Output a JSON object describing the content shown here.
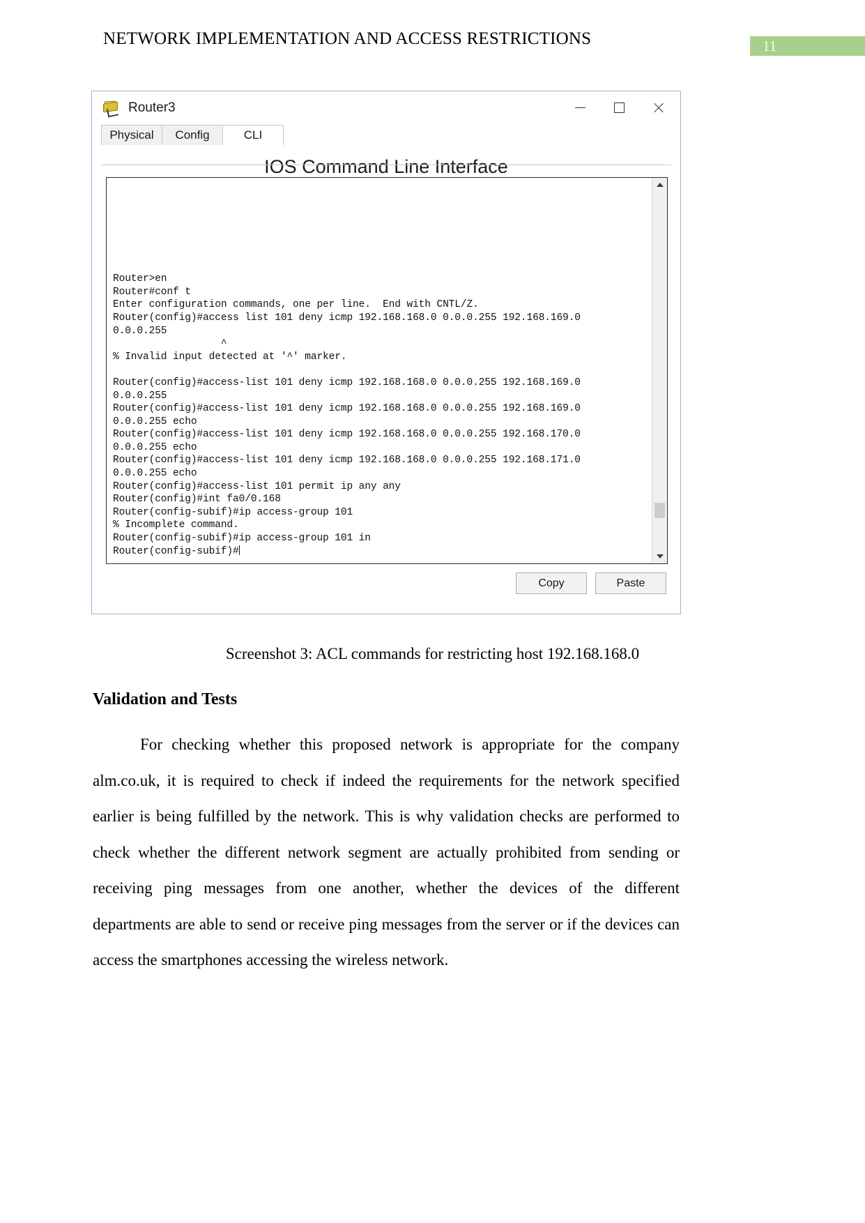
{
  "header": {
    "title": "NETWORK IMPLEMENTATION AND ACCESS RESTRICTIONS",
    "page_number": "11",
    "banner_color": "#a8d08d"
  },
  "window": {
    "title": "Router3",
    "icon": "router-icon",
    "minimize_label": "—",
    "maximize_label": "□",
    "close_label": "✕",
    "tabs": [
      {
        "label": "Physical",
        "active": false
      },
      {
        "label": "Config",
        "active": false
      },
      {
        "label": "CLI",
        "active": true
      }
    ],
    "cli_heading": "IOS Command Line Interface",
    "buttons": {
      "copy": "Copy",
      "paste": "Paste"
    }
  },
  "terminal": {
    "lines": [
      "",
      "",
      "",
      "",
      "",
      "",
      "",
      "Router>en",
      "Router#conf t",
      "Enter configuration commands, one per line.  End with CNTL/Z.",
      "Router(config)#access list 101 deny icmp 192.168.168.0 0.0.0.255 192.168.169.0",
      "0.0.0.255",
      "                  ^",
      "% Invalid input detected at '^' marker.",
      "",
      "Router(config)#access-list 101 deny icmp 192.168.168.0 0.0.0.255 192.168.169.0",
      "0.0.0.255",
      "Router(config)#access-list 101 deny icmp 192.168.168.0 0.0.0.255 192.168.169.0",
      "0.0.0.255 echo",
      "Router(config)#access-list 101 deny icmp 192.168.168.0 0.0.0.255 192.168.170.0",
      "0.0.0.255 echo",
      "Router(config)#access-list 101 deny icmp 192.168.168.0 0.0.0.255 192.168.171.0",
      "0.0.0.255 echo",
      "Router(config)#access-list 101 permit ip any any",
      "Router(config)#int fa0/0.168",
      "Router(config-subif)#ip access-group 101",
      "% Incomplete command.",
      "Router(config-subif)#ip access-group 101 in"
    ],
    "prompt": "Router(config-subif)#"
  },
  "document": {
    "caption": "Screenshot 3: ACL commands for restricting host 192.168.168.0",
    "section_heading": "Validation and Tests",
    "paragraph": "For checking whether this proposed network is appropriate for the company alm.co.uk, it is required to check if indeed the requirements for the network specified earlier is being fulfilled by the network. This is why validation checks are performed to check whether the different network segment are actually prohibited from sending or receiving ping messages from one another, whether the devices of the different departments are able to send or receive ping messages from the server or if the devices can access the smartphones accessing the wireless network."
  }
}
